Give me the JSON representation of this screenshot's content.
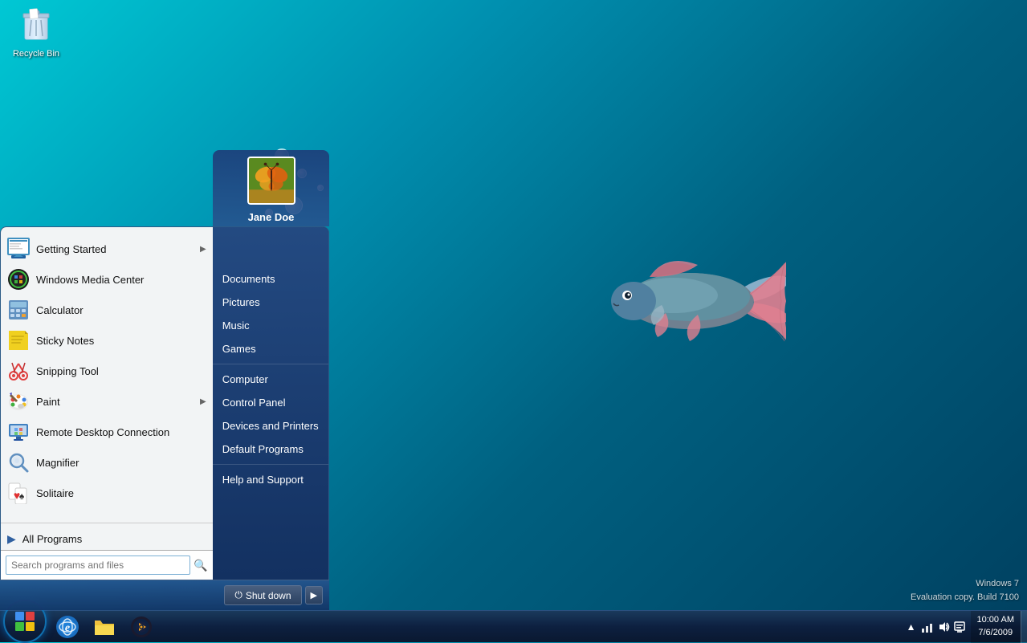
{
  "desktop": {
    "recycle_bin_label": "Recycle Bin"
  },
  "start_menu": {
    "user": {
      "name": "Jane Doe"
    },
    "left_items": [
      {
        "id": "getting-started",
        "label": "Getting Started",
        "has_arrow": true,
        "icon": "getting-started"
      },
      {
        "id": "windows-media-center",
        "label": "Windows Media Center",
        "has_arrow": false,
        "icon": "wmc"
      },
      {
        "id": "calculator",
        "label": "Calculator",
        "has_arrow": false,
        "icon": "calc"
      },
      {
        "id": "sticky-notes",
        "label": "Sticky Notes",
        "has_arrow": false,
        "icon": "sticky"
      },
      {
        "id": "snipping-tool",
        "label": "Snipping Tool",
        "has_arrow": false,
        "icon": "snip"
      },
      {
        "id": "paint",
        "label": "Paint",
        "has_arrow": true,
        "icon": "paint"
      },
      {
        "id": "remote-desktop",
        "label": "Remote Desktop Connection",
        "has_arrow": false,
        "icon": "rdp"
      },
      {
        "id": "magnifier",
        "label": "Magnifier",
        "has_arrow": false,
        "icon": "mag"
      },
      {
        "id": "solitaire",
        "label": "Solitaire",
        "has_arrow": false,
        "icon": "sol"
      }
    ],
    "all_programs_label": "All Programs",
    "search_placeholder": "Search programs and files",
    "right_items": [
      {
        "id": "documents",
        "label": "Documents"
      },
      {
        "id": "pictures",
        "label": "Pictures"
      },
      {
        "id": "music",
        "label": "Music"
      },
      {
        "id": "games",
        "label": "Games"
      },
      {
        "id": "computer",
        "label": "Computer"
      },
      {
        "id": "control-panel",
        "label": "Control Panel"
      },
      {
        "id": "devices-printers",
        "label": "Devices and Printers"
      },
      {
        "id": "default-programs",
        "label": "Default Programs"
      },
      {
        "id": "help-support",
        "label": "Help and Support"
      }
    ],
    "shutdown_label": "Shut down"
  },
  "taskbar": {
    "time": "10:00 AM",
    "date": "7/6/2009",
    "win_label": "Windows 7",
    "eval_label": "Evaluation copy. Build 7100"
  }
}
